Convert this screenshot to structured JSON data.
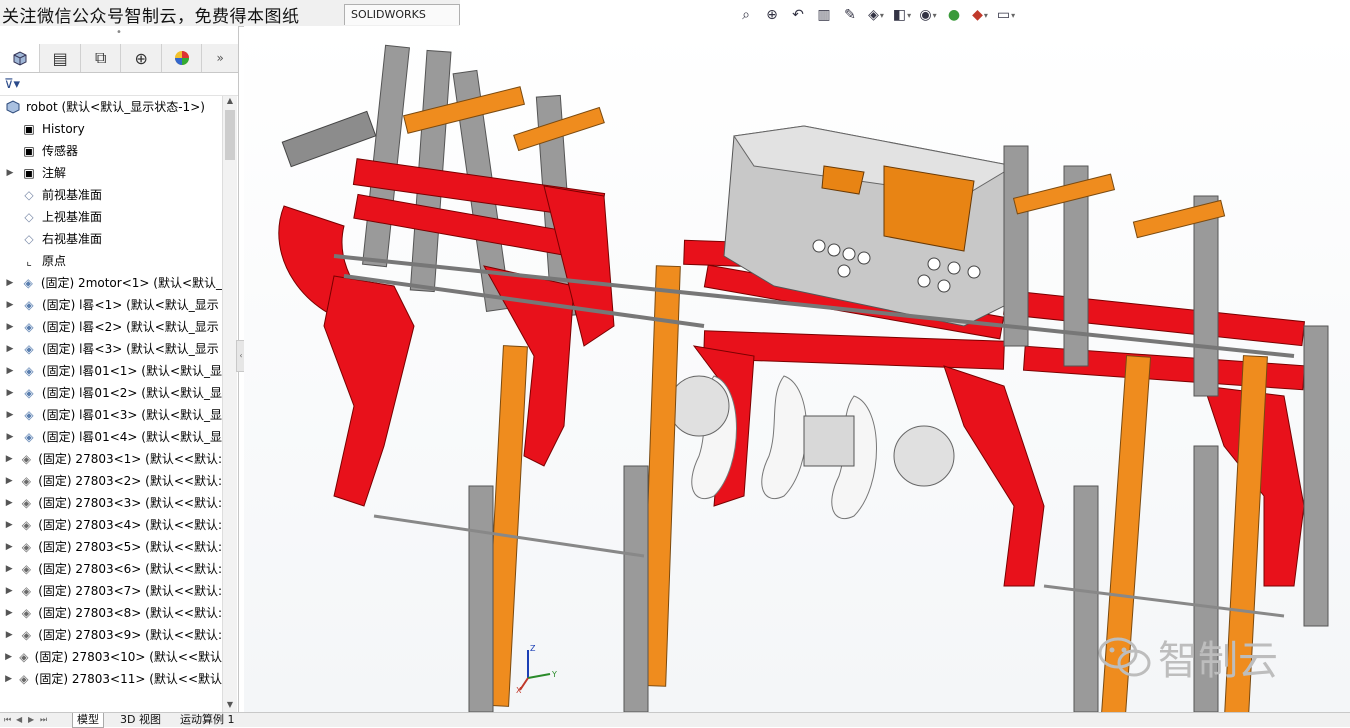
{
  "top_tabs": {
    "watermark": "关注微信公众号智制云，免费得本图纸",
    "mbd_tab": "SOLIDWORKS MBD"
  },
  "hud_icons": [
    "zoom-to-fit-icon",
    "zoom-area-icon",
    "previous-view-icon",
    "section-view-icon",
    "dynamic-annotation-icon",
    "view-orientation-icon",
    "display-style-icon",
    "hide-show-icon",
    "edit-appearance-icon",
    "apply-scene-icon",
    "view-settings-icon"
  ],
  "panel": {
    "tabs": [
      "featuremanager-icon",
      "propertymanager-icon",
      "configurationmanager-icon",
      "dimxpert-icon",
      "display-manager-icon"
    ],
    "more": "»",
    "filter_icon": "filter-icon"
  },
  "tree": {
    "root": "robot  (默认<默认_显示状态-1>)",
    "items": [
      {
        "label": "History",
        "icon": "history-icon",
        "kind": "folder",
        "exp": ""
      },
      {
        "label": "传感器",
        "icon": "sensor-icon",
        "kind": "folder",
        "exp": ""
      },
      {
        "label": "注解",
        "icon": "annotation-icon",
        "kind": "folder",
        "exp": "▶"
      },
      {
        "label": "前视基准面",
        "icon": "plane-icon",
        "kind": "plane",
        "exp": ""
      },
      {
        "label": "上视基准面",
        "icon": "plane-icon",
        "kind": "plane",
        "exp": ""
      },
      {
        "label": "右视基准面",
        "icon": "plane-icon",
        "kind": "plane",
        "exp": ""
      },
      {
        "label": "原点",
        "icon": "origin-icon",
        "kind": "origin",
        "exp": ""
      },
      {
        "label": "(固定) 2motor<1> (默认<默认_",
        "icon": "subassembly-icon",
        "kind": "part",
        "exp": "▶"
      },
      {
        "label": "(固定) l晷<1> (默认<默认_显示",
        "icon": "subassembly-icon",
        "kind": "part",
        "exp": "▶"
      },
      {
        "label": "(固定) l晷<2> (默认<默认_显示",
        "icon": "subassembly-icon",
        "kind": "part",
        "exp": "▶"
      },
      {
        "label": "(固定) l晷<3> (默认<默认_显示",
        "icon": "subassembly-icon",
        "kind": "part",
        "exp": "▶"
      },
      {
        "label": "(固定) l晷01<1> (默认<默认_显",
        "icon": "subassembly-icon",
        "kind": "part",
        "exp": "▶"
      },
      {
        "label": "(固定) l晷01<2> (默认<默认_显",
        "icon": "subassembly-icon",
        "kind": "part",
        "exp": "▶"
      },
      {
        "label": "(固定) l晷01<3> (默认<默认_显",
        "icon": "subassembly-icon",
        "kind": "part",
        "exp": "▶"
      },
      {
        "label": "(固定) l晷01<4> (默认<默认_显",
        "icon": "subassembly-icon",
        "kind": "part",
        "exp": "▶"
      },
      {
        "label": "(固定) 27803<1> (默认<<默认:",
        "icon": "part-icon",
        "kind": "gray",
        "exp": "▶"
      },
      {
        "label": "(固定) 27803<2> (默认<<默认:",
        "icon": "part-icon",
        "kind": "gray",
        "exp": "▶"
      },
      {
        "label": "(固定) 27803<3> (默认<<默认:",
        "icon": "part-icon",
        "kind": "gray",
        "exp": "▶"
      },
      {
        "label": "(固定) 27803<4> (默认<<默认:",
        "icon": "part-icon",
        "kind": "gray",
        "exp": "▶"
      },
      {
        "label": "(固定) 27803<5> (默认<<默认:",
        "icon": "part-icon",
        "kind": "gray",
        "exp": "▶"
      },
      {
        "label": "(固定) 27803<6> (默认<<默认:",
        "icon": "part-icon",
        "kind": "gray",
        "exp": "▶"
      },
      {
        "label": "(固定) 27803<7> (默认<<默认:",
        "icon": "part-icon",
        "kind": "gray",
        "exp": "▶"
      },
      {
        "label": "(固定) 27803<8> (默认<<默认:",
        "icon": "part-icon",
        "kind": "gray",
        "exp": "▶"
      },
      {
        "label": "(固定) 27803<9> (默认<<默认:",
        "icon": "part-icon",
        "kind": "gray",
        "exp": "▶"
      },
      {
        "label": "(固定) 27803<10> (默认<<默认",
        "icon": "part-icon",
        "kind": "gray",
        "exp": "▶"
      },
      {
        "label": "(固定) 27803<11> (默认<<默认",
        "icon": "part-icon",
        "kind": "gray",
        "exp": "▶"
      }
    ]
  },
  "bottom_tabs": {
    "model": "模型",
    "view3d": "3D 视图",
    "motion": "运动算例 1"
  },
  "watermark_bottom": "智制云",
  "triad": {
    "x": "X",
    "y": "Y",
    "z": "Z"
  },
  "colors": {
    "red": "#e8111b",
    "gray": "#9a9a9a",
    "orange": "#ef8c1e",
    "nxt_orange": "#e88414"
  }
}
